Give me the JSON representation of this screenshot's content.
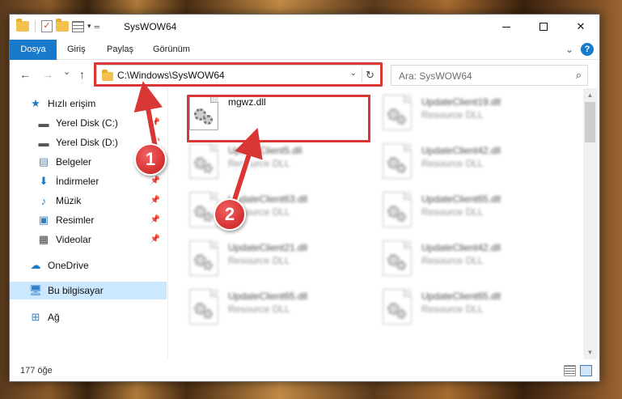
{
  "window": {
    "title": "SysWOW64",
    "minimize": "—",
    "maximize": "☐",
    "close": "✕"
  },
  "ribbon": {
    "tabs": [
      {
        "label": "Dosya"
      },
      {
        "label": "Giriş"
      },
      {
        "label": "Paylaş"
      },
      {
        "label": "Görünüm"
      }
    ],
    "expand_icon": "chevron-down-icon",
    "help_icon": "help-icon",
    "help_glyph": "?",
    "accent": "#1979ca"
  },
  "nav": {
    "back": "←",
    "forward": "→",
    "up_recent": "⌄",
    "up": "↑",
    "address": "C:\\Windows\\SysWOW64",
    "search_placeholder": "Ara: SysWOW64"
  },
  "sidebar": {
    "items": [
      {
        "label": "Hızlı erişim",
        "icon": "star-icon"
      },
      {
        "label": "Yerel Disk (C:)",
        "icon": "drive-icon",
        "pinned": true
      },
      {
        "label": "Yerel Disk (D:)",
        "icon": "drive-icon",
        "pinned": true
      },
      {
        "label": "Belgeler",
        "icon": "documents-icon",
        "pinned": true
      },
      {
        "label": "İndirmeler",
        "icon": "download-icon",
        "pinned": true
      },
      {
        "label": "Müzik",
        "icon": "music-icon",
        "pinned": true
      },
      {
        "label": "Resimler",
        "icon": "pictures-icon",
        "pinned": true
      },
      {
        "label": "Videolar",
        "icon": "videos-icon",
        "pinned": true
      },
      {
        "label": "OneDrive",
        "icon": "cloud-icon"
      },
      {
        "label": "Bu bilgisayar",
        "icon": "computer-icon",
        "selected": true
      },
      {
        "label": "Ağ",
        "icon": "network-icon"
      }
    ]
  },
  "files": [
    {
      "name": "mgwz.dll",
      "type": "",
      "highlighted": true
    },
    {
      "name": "UpdateClient19.dll",
      "type": "Resource DLL"
    },
    {
      "name": "UpdateClient5.dll",
      "type": "Resource DLL"
    },
    {
      "name": "UpdateClient42.dll",
      "type": "Resource DLL"
    },
    {
      "name": "UpdateClient63.dll",
      "type": "Resource DLL"
    },
    {
      "name": "UpdateClient65.dll",
      "type": "Resource DLL"
    },
    {
      "name": "UpdateClient21.dll",
      "type": "Resource DLL"
    },
    {
      "name": "UpdateClient42.dll",
      "type": "Resource DLL"
    },
    {
      "name": "UpdateClient65.dll",
      "type": "Resource DLL"
    },
    {
      "name": "UpdateClient65.dll",
      "type": "Resource DLL"
    }
  ],
  "status": {
    "count": "177 öğe"
  },
  "annotations": {
    "badge1": "1",
    "badge2": "2",
    "highlight_color": "#d93636"
  }
}
